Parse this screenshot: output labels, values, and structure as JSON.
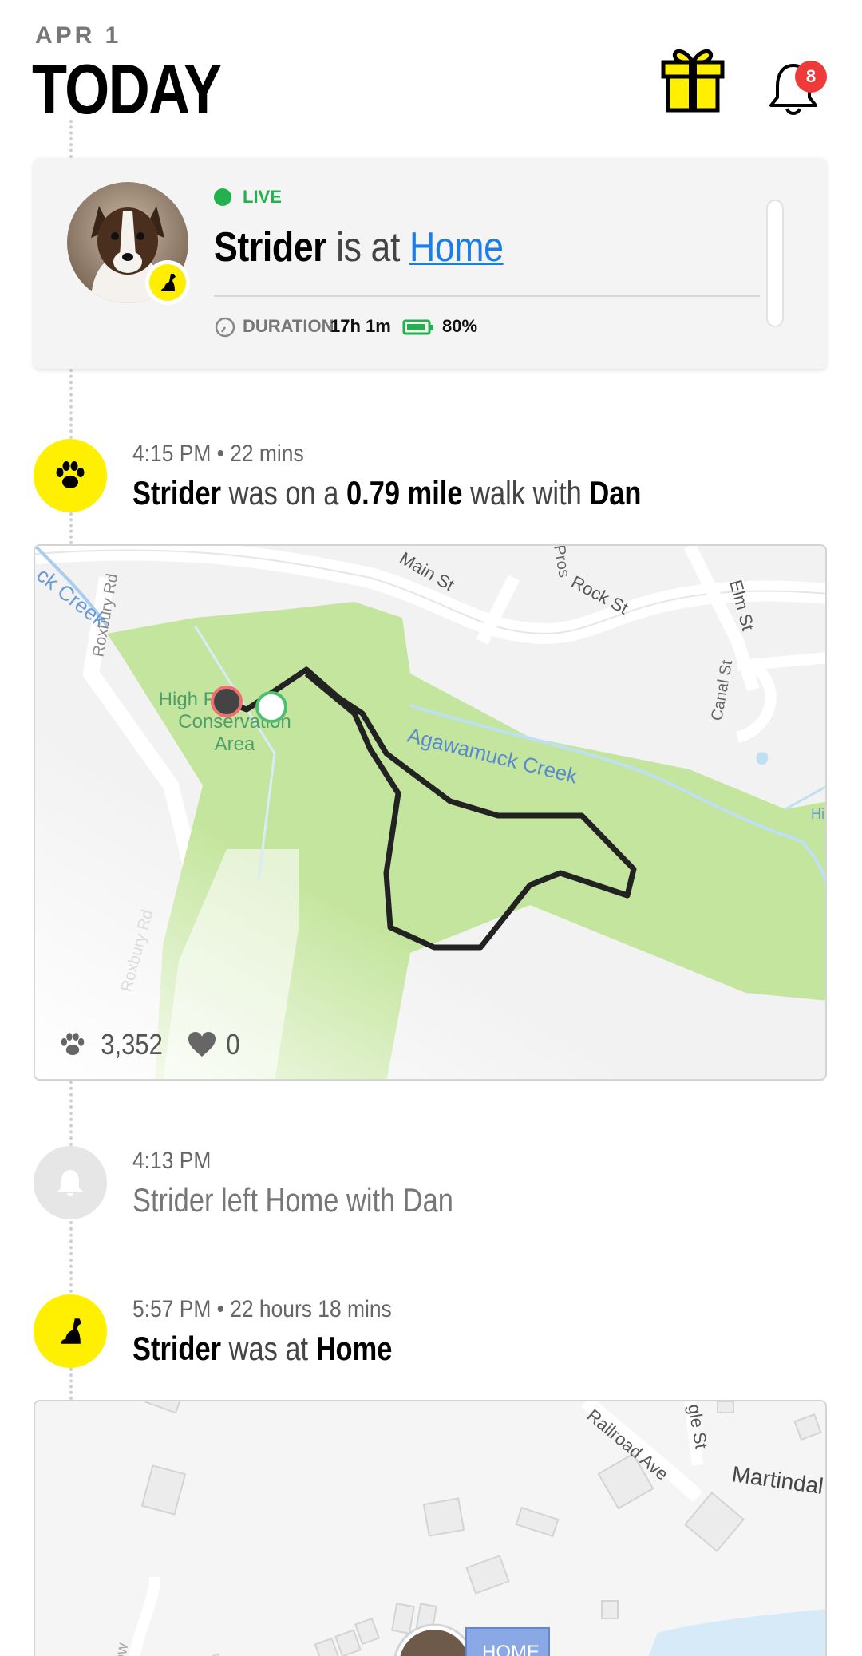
{
  "header": {
    "date": "APR 1",
    "title": "TODAY",
    "notification_count": "8"
  },
  "live_card": {
    "status": "LIVE",
    "pet_name": "Strider",
    "connector": " is at ",
    "location": "Home",
    "duration_label": "DURATION",
    "duration_value": "17h 1m",
    "battery": "80%"
  },
  "events": [
    {
      "time": "4:15 PM • 22 mins",
      "pet": "Strider",
      "t1": " was on a ",
      "distance": "0.79 mile",
      "t2": " walk with ",
      "person": "Dan",
      "steps": "3,352",
      "likes": "0",
      "map_labels": {
        "creek_left": "ck Creek",
        "roxbury_top": "Roxbury Rd",
        "main_st": "Main St",
        "prospect": "Pros",
        "rock_st": "Rock St",
        "elm_st": "Elm St",
        "canal_st": "Canal St",
        "area_line1": "High F",
        "area_line2": "Conservation",
        "area_line3": "Area",
        "creek": "Agawamuck Creek",
        "roxbury_bottom": "Roxbury Rd",
        "edge_label": "Hi"
      }
    },
    {
      "time": "4:13 PM",
      "text": "Strider left Home with Dan"
    },
    {
      "time": "5:57 PM • 22 hours 18 mins",
      "pet": "Strider",
      "t1": " was at ",
      "location": "Home",
      "map_labels": {
        "railroad": "Railroad Ave",
        "gle": "gle St",
        "martindale": "Martindal",
        "low": "Low",
        "home_tag": "HOME"
      }
    }
  ],
  "colors": {
    "accent_yellow": "#ffef00",
    "live_green": "#22b14c",
    "link_blue": "#1a7ee6",
    "badge_red": "#f03a3a"
  }
}
